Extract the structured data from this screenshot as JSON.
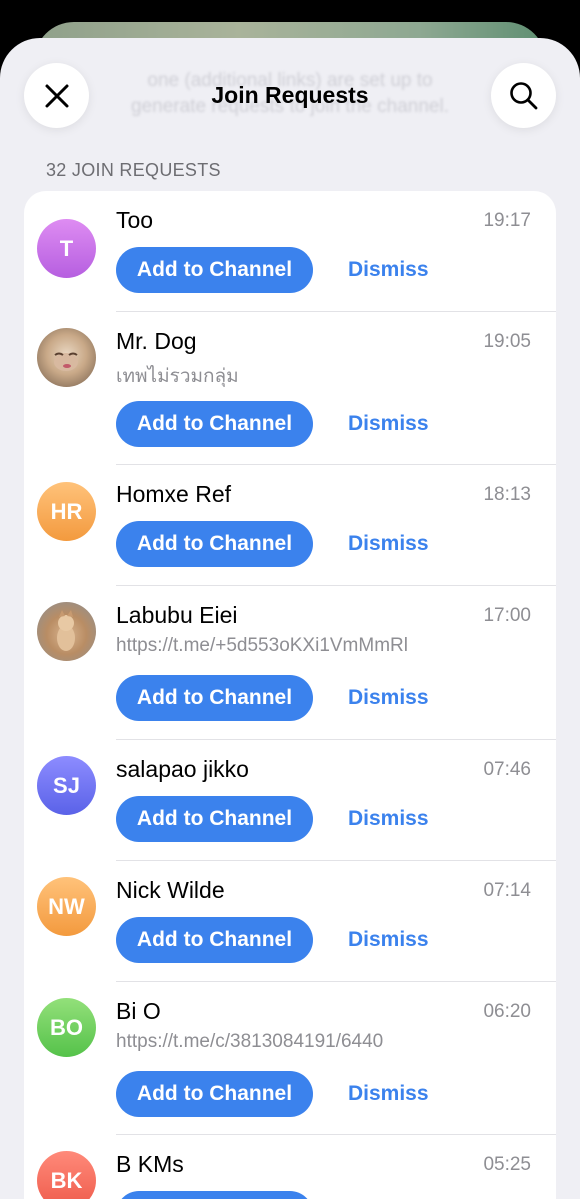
{
  "header": {
    "title": "Join Requests",
    "background_hint": "one (additional links) are set up to generate requests to join the channel.",
    "close_icon": "close-icon",
    "search_icon": "search-icon"
  },
  "section": {
    "label": "32 JOIN REQUESTS"
  },
  "actions": {
    "add_label": "Add to Channel",
    "dismiss_label": "Dismiss"
  },
  "colors": {
    "accent": "#3b82ed",
    "background": "#efeff4"
  },
  "requests": [
    {
      "initials": "T",
      "name": "Too",
      "time": "19:17",
      "subtitle": ""
    },
    {
      "initials": "",
      "name": "Mr. Dog",
      "time": "19:05",
      "subtitle": "เทพไม่รวมกลุ่ม"
    },
    {
      "initials": "HR",
      "name": "Homxe Ref",
      "time": "18:13",
      "subtitle": ""
    },
    {
      "initials": "",
      "name": "Labubu Eiei",
      "time": "17:00",
      "subtitle": "https://t.me/+5d553oKXi1VmMmRl"
    },
    {
      "initials": "SJ",
      "name": "salapao jikko",
      "time": "07:46",
      "subtitle": ""
    },
    {
      "initials": "NW",
      "name": "Nick Wilde",
      "time": "07:14",
      "subtitle": ""
    },
    {
      "initials": "BO",
      "name": "Bi O",
      "time": "06:20",
      "subtitle": "https://t.me/c/3813084191/6440"
    },
    {
      "initials": "BK",
      "name": "B KMs",
      "time": "05:25",
      "subtitle": ""
    }
  ]
}
